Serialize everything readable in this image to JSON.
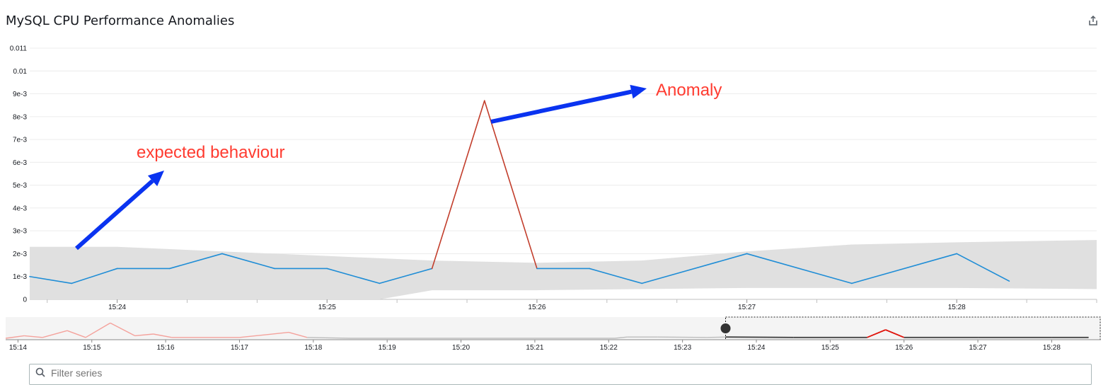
{
  "panel": {
    "title": "MySQL CPU Performance Anomalies",
    "share_icon": "share-icon"
  },
  "chart_data": {
    "type": "line",
    "title": "MySQL CPU Performance Anomalies",
    "xlabel": "",
    "ylabel": "",
    "ylim": [
      0,
      0.011
    ],
    "xlim": [
      "15:23:35",
      "15:28:40"
    ],
    "y_ticks": [
      "0",
      "1e-3",
      "2e-3",
      "3e-3",
      "4e-3",
      "5e-3",
      "6e-3",
      "7e-3",
      "8e-3",
      "9e-3",
      "0.01",
      "0.011"
    ],
    "x_ticks": [
      "15:24",
      "15:25",
      "15:26",
      "15:27",
      "15:28"
    ],
    "grid": true,
    "series": [
      {
        "color": "#1f8dd6",
        "anomaly_color": "#c23d2b",
        "points": [
          [
            "15:23:35",
            0.001
          ],
          [
            "15:23:47",
            0.0007
          ],
          [
            "15:24:00",
            0.00135
          ],
          [
            "15:24:15",
            0.00135
          ],
          [
            "15:24:30",
            0.002
          ],
          [
            "15:24:45",
            0.00135
          ],
          [
            "15:25:00",
            0.00135
          ],
          [
            "15:25:15",
            0.0007
          ],
          [
            "15:25:30",
            0.00135
          ],
          [
            "15:25:45",
            0.0087
          ],
          [
            "15:26:00",
            0.00135
          ],
          [
            "15:26:15",
            0.00135
          ],
          [
            "15:26:30",
            0.0007
          ],
          [
            "15:27:00",
            0.002
          ],
          [
            "15:27:30",
            0.0007
          ],
          [
            "15:28:00",
            0.002
          ],
          [
            "15:28:15",
            0.0008
          ]
        ],
        "anomaly_range": [
          "15:25:30",
          "15:26:00"
        ]
      }
    ],
    "band": {
      "color": "#e0e0e0",
      "points": [
        [
          "15:23:35",
          0.0,
          0.0023
        ],
        [
          "15:24:00",
          0.0,
          0.0023
        ],
        [
          "15:24:30",
          0.0,
          0.0021
        ],
        [
          "15:25:00",
          0.0,
          0.0019
        ],
        [
          "15:25:15",
          0.0,
          0.0018
        ],
        [
          "15:25:30",
          0.0004,
          0.0017
        ],
        [
          "15:26:00",
          0.0004,
          0.0016
        ],
        [
          "15:26:30",
          0.00045,
          0.0017
        ],
        [
          "15:27:00",
          0.0005,
          0.0021
        ],
        [
          "15:27:30",
          0.0005,
          0.0024
        ],
        [
          "15:28:00",
          0.0005,
          0.0025
        ],
        [
          "15:28:40",
          0.00045,
          0.0026
        ]
      ]
    },
    "annotations": [
      {
        "text": "expected behaviour"
      },
      {
        "text": "Anomaly"
      }
    ],
    "navigator": {
      "x_ticks": [
        "15:14",
        "15:15",
        "15:16",
        "15:17",
        "15:18",
        "15:19",
        "15:20",
        "15:21",
        "15:22",
        "15:23",
        "15:24",
        "15:25",
        "15:26",
        "15:27",
        "15:28"
      ],
      "xlim": [
        "15:13:50",
        "15:28:40"
      ],
      "selected_range": [
        "15:23:35",
        "15:28:40"
      ],
      "old_anomaly_color": "#f4a29c",
      "anomaly_color": "#e0140c",
      "line_color": "#444444",
      "points": [
        [
          "15:13:50",
          0.0
        ],
        [
          "15:14:05",
          0.3
        ],
        [
          "15:14:20",
          0.1
        ],
        [
          "15:14:40",
          0.9
        ],
        [
          "15:14:55",
          0.1
        ],
        [
          "15:15:15",
          1.8
        ],
        [
          "15:15:35",
          0.3
        ],
        [
          "15:15:50",
          0.5
        ],
        [
          "15:16:05",
          0.1
        ],
        [
          "15:17:00",
          0.1
        ],
        [
          "15:17:40",
          0.7
        ],
        [
          "15:17:55",
          0.1
        ],
        [
          "15:18:30",
          0.0
        ],
        [
          "15:22:05",
          0.0
        ],
        [
          "15:22:15",
          0.15
        ],
        [
          "15:22:40",
          0.15
        ],
        [
          "15:23:20",
          0.1
        ],
        [
          "15:23:35",
          0.15
        ],
        [
          "15:24:30",
          0.1
        ],
        [
          "15:25:30",
          0.1
        ],
        [
          "15:25:45",
          1.0
        ],
        [
          "15:26:00",
          0.1
        ],
        [
          "15:27:00",
          0.1
        ],
        [
          "15:28:00",
          0.1
        ],
        [
          "15:28:30",
          0.1
        ]
      ],
      "old_anomaly_range": [
        "15:13:50",
        "15:18:05"
      ],
      "new_anomaly_range": [
        "15:25:30",
        "15:26:00"
      ]
    }
  },
  "filter": {
    "placeholder": "Filter series"
  }
}
